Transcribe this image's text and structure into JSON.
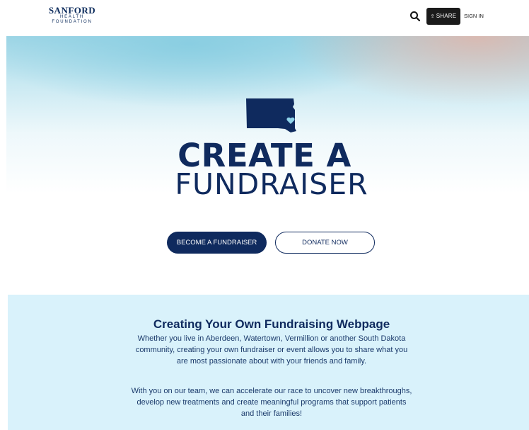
{
  "header": {
    "logo": {
      "line1": "SANFORD",
      "line2": "HEALTH",
      "line3": "FOUNDATION"
    },
    "share_label": "SHARE",
    "signin_label": "SIGN IN",
    "icons": {
      "search": "search-icon",
      "share": "share-icon"
    }
  },
  "hero": {
    "title_line1": "CREATE A",
    "title_line2": "FUNDRAISER",
    "state_icon": "south-dakota-map-icon"
  },
  "actions": {
    "primary_label": "BECOME A FUNDRAISER",
    "secondary_label": "DONATE NOW"
  },
  "info": {
    "title": "Creating Your Own Fundraising Webpage",
    "paragraph1": "Whether you live in Aberdeen, Watertown, Vermillion or another South Dakota community, creating your own fundraiser or event allows you to share what you are most passionate about with your friends and family.",
    "paragraph2": "With you on our team, we can accelerate our race to uncover new breakthroughs, develop new treatments and create meaningful programs that support patients and their families!"
  },
  "colors": {
    "navy": "#0f2a5e",
    "light_blue_panel": "#d9f2fb",
    "share_bg": "#1b1b1b"
  }
}
